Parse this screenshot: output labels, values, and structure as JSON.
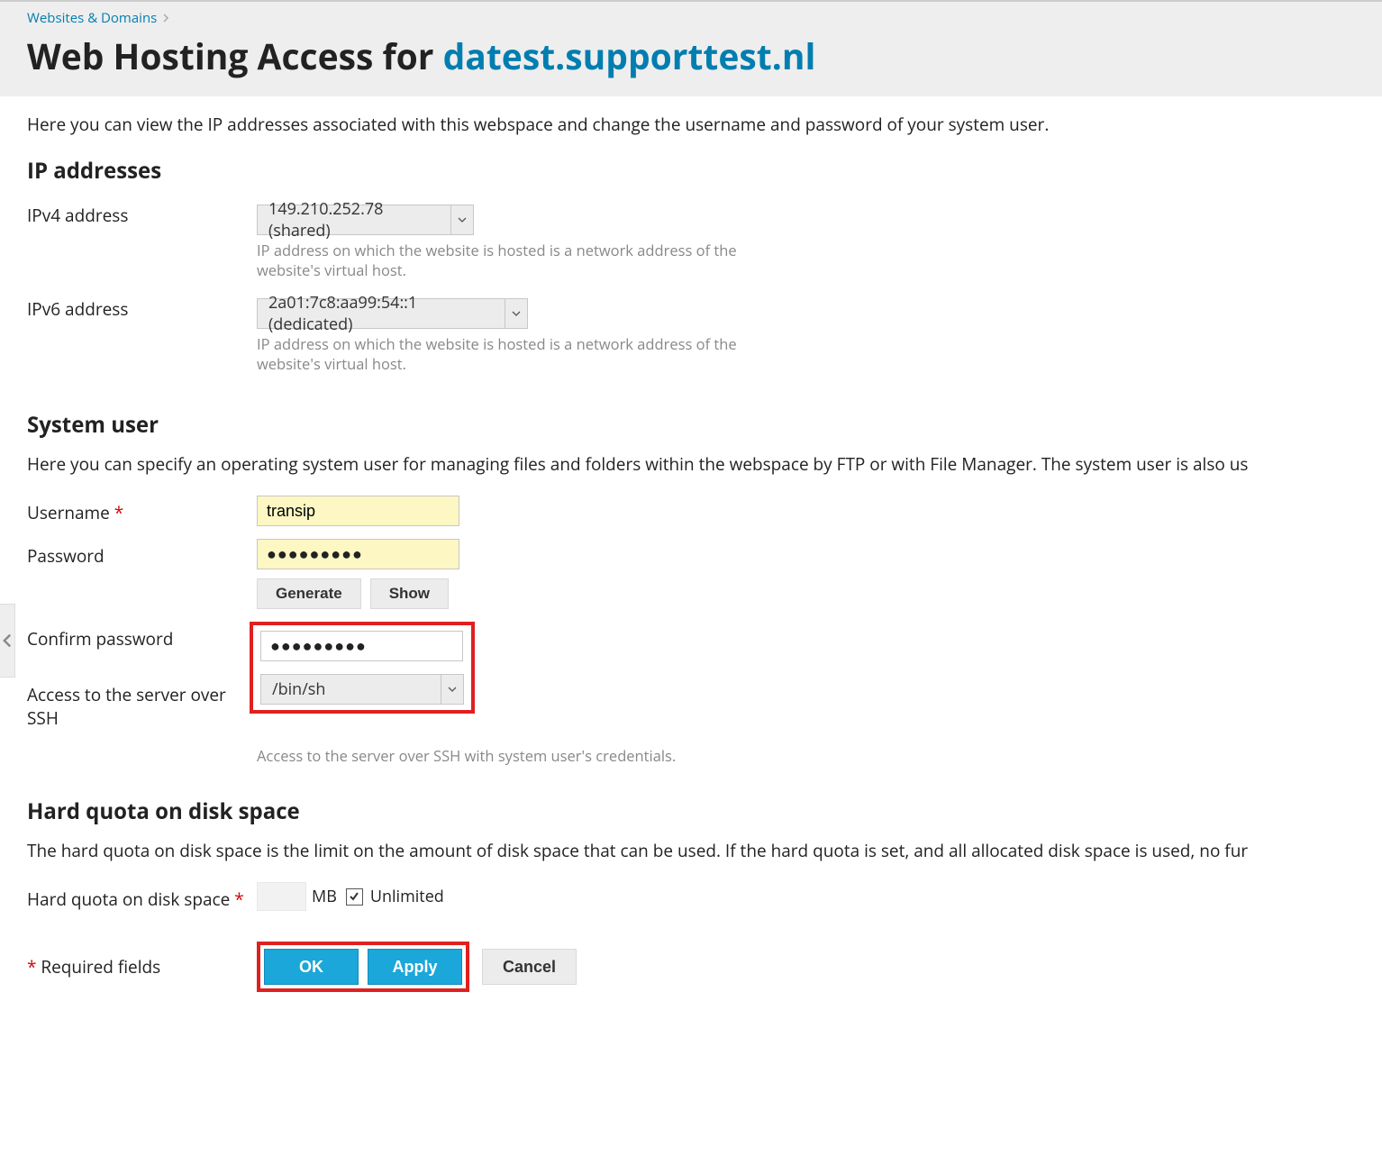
{
  "breadcrumb": {
    "label": "Websites & Domains"
  },
  "title": {
    "prefix": "Web Hosting Access for ",
    "domain": "datest.supporttest.nl"
  },
  "intro": "Here you can view the IP addresses associated with this webspace and change the username and password of your system user.",
  "ip": {
    "heading": "IP addresses",
    "ipv4_label": "IPv4 address",
    "ipv4_value": "149.210.252.78 (shared)",
    "ipv4_help": "IP address on which the website is hosted is a network address of the website's virtual host.",
    "ipv6_label": "IPv6 address",
    "ipv6_value": "2a01:7c8:aa99:54::1 (dedicated)",
    "ipv6_help": "IP address on which the website is hosted is a network address of the website's virtual host."
  },
  "sysuser": {
    "heading": "System user",
    "intro": "Here you can specify an operating system user for managing files and folders within the webspace by FTP or with File Manager. The system user is also us",
    "username_label": "Username",
    "username_value": "transip",
    "password_label": "Password",
    "password_value": "●●●●●●●●●",
    "generate": "Generate",
    "show": "Show",
    "confirm_label": "Confirm password",
    "confirm_value": "●●●●●●●●●",
    "ssh_label": "Access to the server over SSH",
    "ssh_value": "/bin/sh",
    "ssh_help": "Access to the server over SSH with system user's credentials."
  },
  "quota": {
    "heading": "Hard quota on disk space",
    "intro": "The hard quota on disk space is the limit on the amount of disk space that can be used. If the hard quota is set, and all allocated disk space is used, no fur",
    "label": "Hard quota on disk space",
    "mb": "MB",
    "unlimited": "Unlimited",
    "unlimited_checked": true
  },
  "footer": {
    "required": "Required fields",
    "ok": "OK",
    "apply": "Apply",
    "cancel": "Cancel"
  }
}
